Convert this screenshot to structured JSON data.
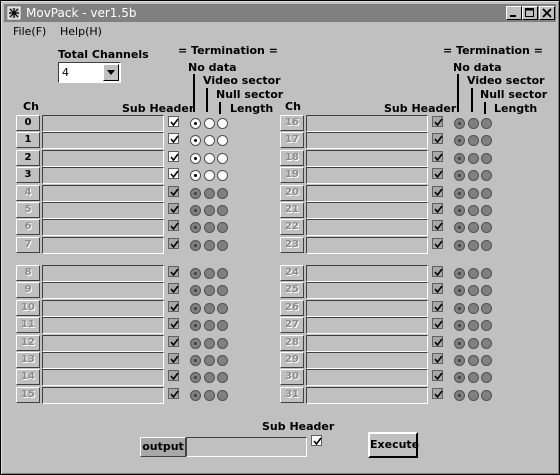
{
  "window": {
    "title": "MovPack  - ver1.5b"
  },
  "menu": {
    "items": [
      "File(F)",
      "Help(H)"
    ]
  },
  "total_channels": {
    "label": "Total Channels",
    "value": "4"
  },
  "termination": {
    "title": "= Termination =",
    "headers": [
      "No data",
      "Video sector",
      "Null sector",
      "Length"
    ]
  },
  "column_headers": {
    "ch": "Ch",
    "sub_header": "Sub Header"
  },
  "channels": [
    {
      "num": "0",
      "enabled": true
    },
    {
      "num": "1",
      "enabled": true
    },
    {
      "num": "2",
      "enabled": true
    },
    {
      "num": "3",
      "enabled": true
    },
    {
      "num": "4",
      "enabled": false
    },
    {
      "num": "5",
      "enabled": false
    },
    {
      "num": "6",
      "enabled": false
    },
    {
      "num": "7",
      "enabled": false
    },
    {
      "num": "8",
      "enabled": false
    },
    {
      "num": "9",
      "enabled": false
    },
    {
      "num": "10",
      "enabled": false
    },
    {
      "num": "11",
      "enabled": false
    },
    {
      "num": "12",
      "enabled": false
    },
    {
      "num": "13",
      "enabled": false
    },
    {
      "num": "14",
      "enabled": false
    },
    {
      "num": "15",
      "enabled": false
    },
    {
      "num": "16",
      "enabled": false
    },
    {
      "num": "17",
      "enabled": false
    },
    {
      "num": "18",
      "enabled": false
    },
    {
      "num": "19",
      "enabled": false
    },
    {
      "num": "20",
      "enabled": false
    },
    {
      "num": "21",
      "enabled": false
    },
    {
      "num": "22",
      "enabled": false
    },
    {
      "num": "23",
      "enabled": false
    },
    {
      "num": "24",
      "enabled": false
    },
    {
      "num": "25",
      "enabled": false
    },
    {
      "num": "26",
      "enabled": false
    },
    {
      "num": "27",
      "enabled": false
    },
    {
      "num": "28",
      "enabled": false
    },
    {
      "num": "29",
      "enabled": false
    },
    {
      "num": "30",
      "enabled": false
    },
    {
      "num": "31",
      "enabled": false
    }
  ],
  "output": {
    "button_label": "output",
    "sub_header_label": "Sub Header",
    "value": ""
  },
  "execute": {
    "label": "Execute"
  },
  "colors": {
    "titlebar": "#808080",
    "face": "#c0c0c0",
    "enabled_text": "#000000",
    "disabled_text": "#8c8c8c"
  }
}
